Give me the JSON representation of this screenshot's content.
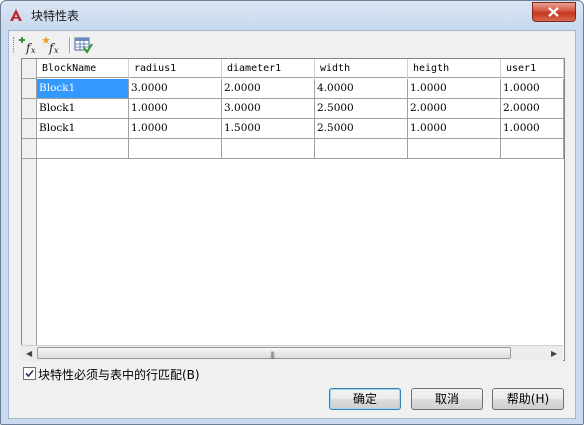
{
  "window": {
    "title": "块特性表"
  },
  "toolbar": {
    "buttons": [
      {
        "icon": "add-parameter-icon"
      },
      {
        "icon": "add-user-parameter-icon"
      },
      {
        "icon": "audit-table-icon"
      }
    ]
  },
  "table": {
    "columns": [
      "BlockName",
      "radius1",
      "diameter1",
      "width",
      "heigth",
      "user1"
    ],
    "rows": [
      [
        "Block1",
        "3.0000",
        "2.0000",
        "4.0000",
        "1.0000",
        "1.0000"
      ],
      [
        "Block1",
        "1.0000",
        "3.0000",
        "2.5000",
        "2.0000",
        "2.0000"
      ],
      [
        "Block1",
        "1.0000",
        "1.5000",
        "2.5000",
        "1.0000",
        "1.0000"
      ],
      [
        "",
        "",
        "",
        "",
        "",
        ""
      ]
    ],
    "selected": {
      "row": 0,
      "col": 0
    }
  },
  "checkbox": {
    "label": "块特性必须与表中的行匹配(B)",
    "checked": true
  },
  "buttons": {
    "ok": "确定",
    "cancel": "取消",
    "help": "帮助(H)"
  },
  "colors": {
    "selection": "#3399ff",
    "close": "#c4361c"
  }
}
